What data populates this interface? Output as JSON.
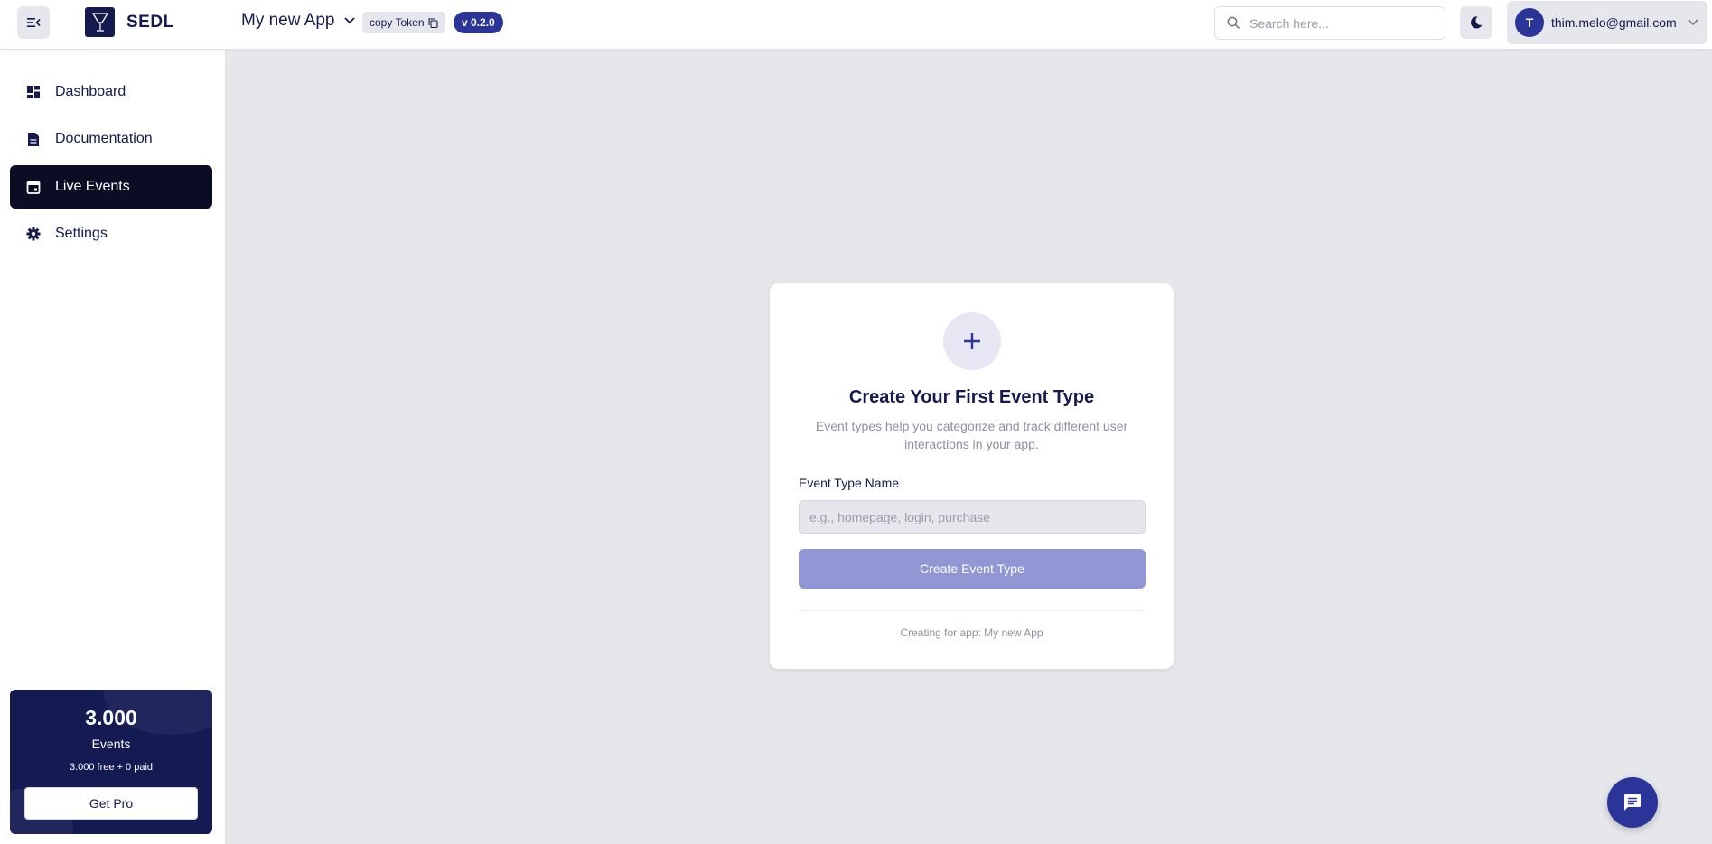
{
  "header": {
    "logo_text": "SEDL",
    "app_name": "My new App",
    "token_label": "copy Token",
    "version": "v 0.2.0",
    "search_placeholder": "Search here...",
    "user_initial": "T",
    "user_email": "thim.melo@gmail.com"
  },
  "sidebar": {
    "items": [
      {
        "label": "Dashboard",
        "icon": "dashboard-icon",
        "active": false
      },
      {
        "label": "Documentation",
        "icon": "document-icon",
        "active": false
      },
      {
        "label": "Live Events",
        "icon": "calendar-icon",
        "active": true
      },
      {
        "label": "Settings",
        "icon": "gear-icon",
        "active": false
      }
    ],
    "promo": {
      "count": "3.000",
      "label": "Events",
      "sub": "3.000 free + 0 paid",
      "button": "Get Pro"
    }
  },
  "card": {
    "title": "Create Your First Event Type",
    "description": "Event types help you categorize and track different user interactions in your app.",
    "field_label": "Event Type Name",
    "field_placeholder": "e.g., homepage, login, purchase",
    "button": "Create Event Type",
    "footer": "Creating for app: My new App"
  },
  "colors": {
    "primary": "#2b3499",
    "dark": "#141a4d",
    "active_nav": "#0b0d24",
    "button_disabled": "#9097d4",
    "background": "#e5e7eb"
  }
}
